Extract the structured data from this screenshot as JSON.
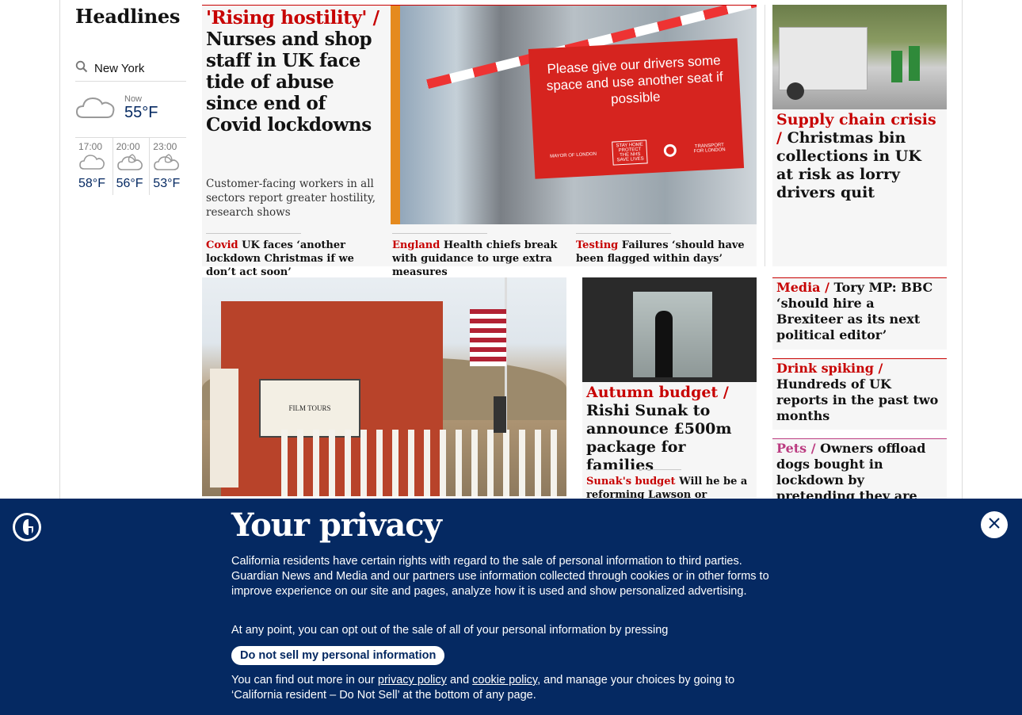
{
  "section": {
    "title": "Headlines"
  },
  "weather": {
    "location": "New York",
    "now_label": "Now",
    "now_temp": "55°F",
    "forecast": [
      {
        "time": "17:00",
        "temp": "58°F"
      },
      {
        "time": "20:00",
        "temp": "56°F"
      },
      {
        "time": "23:00",
        "temp": "53°F"
      }
    ]
  },
  "lead": {
    "kicker": "'Rising hostility' /",
    "headline": "Nurses and shop staff in UK face tide of abuse since end of Covid lockdowns",
    "standfirst": "Customer-facing workers in all sectors report greater hostility, research shows",
    "sign_text": "Please give our drivers some space and use another seat if possible",
    "sign_footer_left": "MAYOR OF LONDON",
    "sign_footer_mid": "STAY HOME PROTECT THE NHS SAVE LIVES",
    "sign_footer_right": "TRANSPORT FOR LONDON",
    "sublinks": [
      {
        "kicker": "Covid",
        "text": "UK faces ‘another lockdown Christmas if we don’t act soon’"
      },
      {
        "kicker": "England",
        "text": "Health chiefs break with guidance to urge extra measures"
      },
      {
        "kicker": "Testing",
        "text": "Failures ‘should have been flagged within days’"
      }
    ]
  },
  "supply": {
    "kicker": "Supply chain crisis /",
    "headline": "Christmas bin collections in UK at risk as lorry drivers quit"
  },
  "film": {
    "sign_text": "FILM TOURS"
  },
  "budget": {
    "kicker": "Autumn budget /",
    "headline": "Rishi Sunak to announce £500m package for families",
    "sublink_kicker": "Sunak's budget",
    "sublink_text": "Will he be a reforming Lawson or austerity"
  },
  "right_list": [
    {
      "kicker": "Media /",
      "text": "Tory MP: BBC ‘should hire a Brexiteer as its next political editor’"
    },
    {
      "kicker": "Drink spiking /",
      "text": "Hundreds of UK reports in the past two months"
    },
    {
      "kicker": "Pets /",
      "text": "Owners offload dogs bought in lockdown by pretending they are strays"
    }
  ],
  "privacy": {
    "title": "Your privacy",
    "body1": "California residents have certain rights with regard to the sale of personal information to third parties. Guardian News and Media and our partners use information collected through cookies or in other forms to improve experience on our site and pages, analyze how it is used and show personalized advertising.",
    "body2": "At any point, you can opt out of the sale of all of your personal information by pressing",
    "button": "Do not sell my personal information",
    "body3_pre": "You can find out more in our",
    "privacy_link": "privacy policy",
    "and": "and",
    "cookie_link": "cookie policy",
    "body3_post": ", and manage your choices by going to ‘California resident – Do Not Sell’ at the bottom of any page."
  },
  "colors": {
    "brand": "#052962",
    "news": "#c70000",
    "pets": "#bb3b80"
  }
}
